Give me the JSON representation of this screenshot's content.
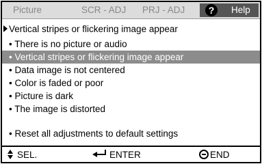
{
  "tabs": [
    {
      "label": "Picture"
    },
    {
      "label": "SCR - ADJ"
    },
    {
      "label": "PRJ - ADJ"
    }
  ],
  "help": {
    "icon": "?",
    "label": "Help",
    "bg": "#555555"
  },
  "heading": "Vertical stripes or flickering image appear",
  "items": [
    {
      "label": "• There is no picture or audio"
    },
    {
      "label": "• Vertical stripes or flickering image appear",
      "selected": true
    },
    {
      "label": "• Data image is not centered"
    },
    {
      "label": "• Color is faded or poor"
    },
    {
      "label": "• Picture is dark"
    },
    {
      "label": "• The image is distorted"
    },
    {
      "label": "• Reset all adjustments to default settings"
    }
  ],
  "footer": {
    "sel": "SEL.",
    "enter": "ENTER",
    "end": "END"
  },
  "colors": {
    "selected_bg": "#8c8c8c",
    "tab_bar": "#dcdcdc",
    "tab_text": "#888888"
  }
}
